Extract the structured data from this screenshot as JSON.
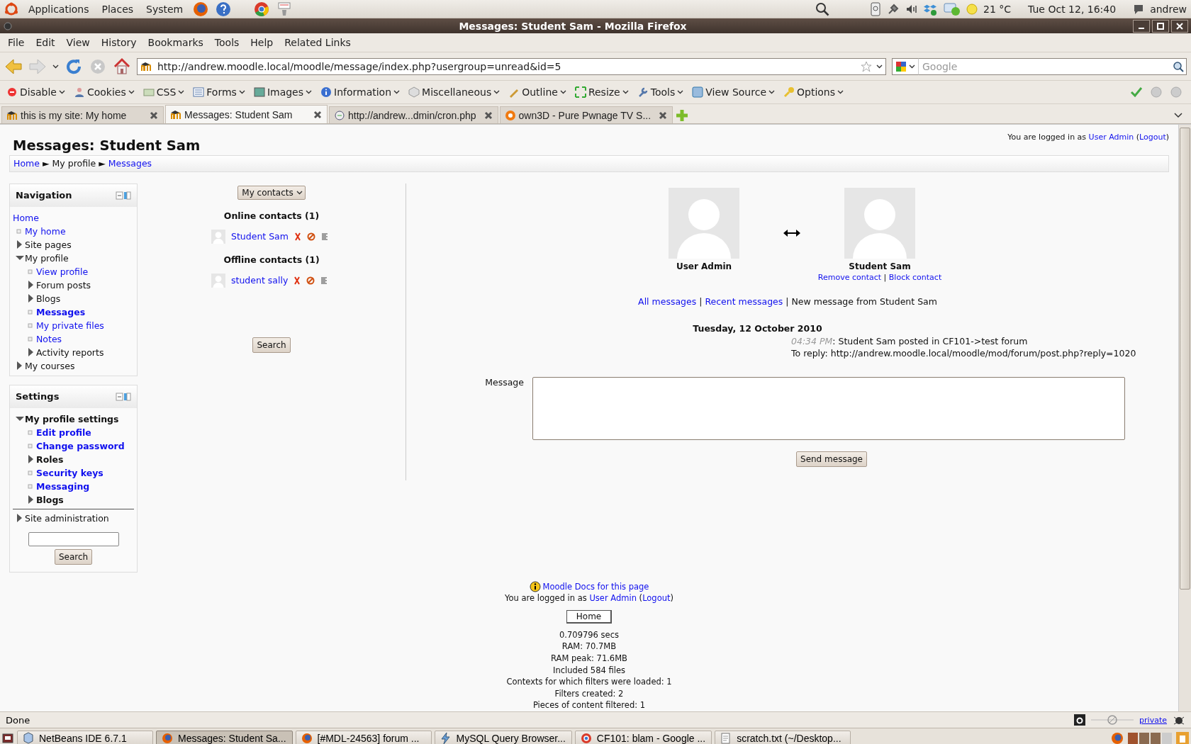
{
  "top_panel": {
    "menus": [
      "Applications",
      "Places",
      "System"
    ],
    "weather": "21 °C",
    "clock": "Tue Oct 12, 16:40",
    "user": "andrew"
  },
  "window": {
    "title": "Messages: Student Sam - Mozilla Firefox"
  },
  "menu_bar": [
    "File",
    "Edit",
    "View",
    "History",
    "Bookmarks",
    "Tools",
    "Help",
    "Related Links"
  ],
  "address_bar": {
    "value": "http://andrew.moodle.local/moodle/message/index.php?usergroup=unread&id=5"
  },
  "search_box": {
    "placeholder": "Google"
  },
  "dev_toolbar": [
    "Disable",
    "Cookies",
    "CSS",
    "Forms",
    "Images",
    "Information",
    "Miscellaneous",
    "Outline",
    "Resize",
    "Tools",
    "View Source",
    "Options"
  ],
  "tabs": [
    {
      "label": "this is my site: My home",
      "selected": false
    },
    {
      "label": "Messages: Student Sam",
      "selected": true
    },
    {
      "label": "http://andrew...dmin/cron.php",
      "selected": false
    },
    {
      "label": "own3D - Pure Pwnage TV S...",
      "selected": false
    }
  ],
  "page": {
    "heading": "Messages: Student Sam",
    "login_info": {
      "prefix": "You are logged in as",
      "user": "User Admin",
      "open": "(",
      "logout": "Logout",
      "close": ")"
    },
    "breadcrumb": {
      "separator": "►",
      "items": [
        {
          "label": "Home",
          "link": true
        },
        {
          "label": "My profile",
          "link": false
        },
        {
          "label": "Messages",
          "link": true
        }
      ]
    },
    "navigation": {
      "title": "Navigation",
      "items": [
        {
          "label": "Home",
          "kind": "link",
          "children": [
            {
              "label": "My home",
              "kind": "link"
            },
            {
              "label": "Site pages",
              "kind": "branch",
              "expanded": false
            },
            {
              "label": "My profile",
              "kind": "branch",
              "expanded": true,
              "children": [
                {
                  "label": "View profile",
                  "kind": "link"
                },
                {
                  "label": "Forum posts",
                  "kind": "branch",
                  "expanded": false
                },
                {
                  "label": "Blogs",
                  "kind": "branch",
                  "expanded": false
                },
                {
                  "label": "Messages",
                  "kind": "current"
                },
                {
                  "label": "My private files",
                  "kind": "link"
                },
                {
                  "label": "Notes",
                  "kind": "link"
                },
                {
                  "label": "Activity reports",
                  "kind": "branch",
                  "expanded": false
                }
              ]
            },
            {
              "label": "My courses",
              "kind": "branch",
              "expanded": false
            }
          ]
        }
      ]
    },
    "settings": {
      "title": "Settings",
      "items": [
        {
          "label": "My profile settings",
          "kind": "branch",
          "expanded": true,
          "children": [
            {
              "label": "Edit profile",
              "kind": "link"
            },
            {
              "label": "Change password",
              "kind": "link"
            },
            {
              "label": "Roles",
              "kind": "branch",
              "expanded": false
            },
            {
              "label": "Security keys",
              "kind": "link"
            },
            {
              "label": "Messaging",
              "kind": "link"
            },
            {
              "label": "Blogs",
              "kind": "branch",
              "expanded": false
            }
          ]
        },
        {
          "label": "Site administration",
          "kind": "branch",
          "expanded": false
        }
      ],
      "search_button": "Search"
    },
    "contacts": {
      "dropdown": "My contacts",
      "groups": [
        {
          "title": "Online contacts (1)",
          "contacts": [
            "Student Sam"
          ]
        },
        {
          "title": "Offline contacts (1)",
          "contacts": [
            "student sally"
          ]
        }
      ],
      "search_button": "Search"
    },
    "conversation": {
      "me": "User Admin",
      "other": "Student Sam",
      "separator": "|",
      "contact_links": [
        "Remove contact",
        "Block contact"
      ],
      "history_links": [
        {
          "label": "All messages",
          "link": true
        },
        {
          "label": "Recent messages",
          "link": true
        },
        {
          "label": "New message from Student Sam",
          "link": false
        }
      ],
      "date": "Tuesday, 12 October 2010",
      "messages": [
        {
          "time": "04:34 PM",
          "text": ": Student Sam posted in CF101->test forum",
          "reply": "To reply: http://andrew.moodle.local/moodle/mod/forum/post.php?reply=1020"
        }
      ],
      "message_label": "Message",
      "send_button": "Send message"
    },
    "footer": {
      "docs_link": "Moodle Docs for this page",
      "login_info": {
        "prefix": "You are logged in as",
        "user": "User Admin",
        "open": "(",
        "logout": "Logout",
        "close": ")"
      },
      "home_button": "Home",
      "stats": [
        "0.709796 secs",
        "RAM: 70.7MB",
        "RAM peak: 71.6MB",
        "Included 584 files",
        "Contexts for which filters were loaded: 1",
        "Filters created: 2",
        "Pieces of content filtered: 1"
      ]
    }
  },
  "status_bar": {
    "text": "Done",
    "private": "private"
  },
  "taskbar": [
    {
      "label": "NetBeans IDE 6.7.1",
      "selected": false
    },
    {
      "label": "Messages: Student Sa...",
      "selected": true
    },
    {
      "label": "[#MDL-24563] forum ...",
      "selected": false
    },
    {
      "label": "MySQL Query Browser...",
      "selected": false
    },
    {
      "label": "CF101: blam - Google ...",
      "selected": false
    },
    {
      "label": "scratch.txt (~/Desktop...",
      "selected": false
    }
  ]
}
